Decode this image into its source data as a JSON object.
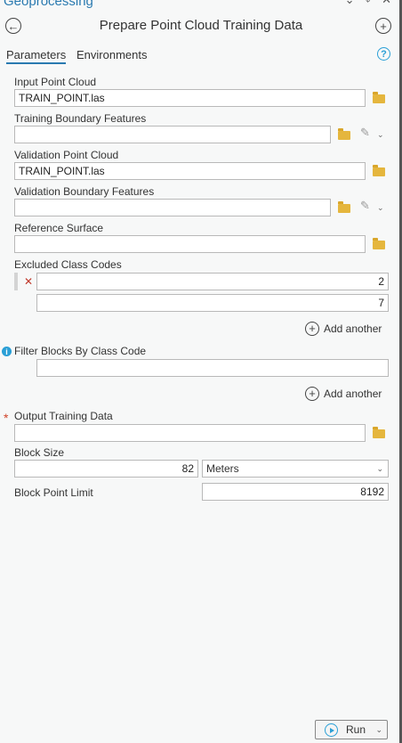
{
  "pane": {
    "title": "Geoprocessing",
    "controls": "⌄ ⌖ ✕"
  },
  "tool": {
    "title": "Prepare Point Cloud Training Data"
  },
  "tabs": [
    {
      "label": "Parameters"
    },
    {
      "label": "Environments"
    }
  ],
  "params": {
    "input_point_cloud": {
      "label": "Input Point Cloud",
      "value": "TRAIN_POINT.las"
    },
    "training_boundary": {
      "label": "Training Boundary Features",
      "value": ""
    },
    "validation_point_cloud": {
      "label": "Validation Point Cloud",
      "value": "TRAIN_POINT.las"
    },
    "validation_boundary": {
      "label": "Validation Boundary Features",
      "value": ""
    },
    "reference_surface": {
      "label": "Reference Surface",
      "value": ""
    },
    "excluded_class_codes": {
      "label": "Excluded Class Codes",
      "values": [
        "2",
        "7"
      ],
      "add_label": "Add another"
    },
    "filter_blocks": {
      "label": "Filter Blocks By Class Code",
      "value": "",
      "add_label": "Add another"
    },
    "output_training_data": {
      "label": "Output Training Data",
      "value": ""
    },
    "block_size": {
      "label": "Block Size",
      "value": "82",
      "unit": "Meters"
    },
    "block_point_limit": {
      "label": "Block Point Limit",
      "value": "8192"
    }
  },
  "run": {
    "label": "Run"
  },
  "colors": {
    "accent": "#2a7ab0",
    "folder": "#e5b63d",
    "required": "#d0442a",
    "info": "#2a9fd6"
  }
}
